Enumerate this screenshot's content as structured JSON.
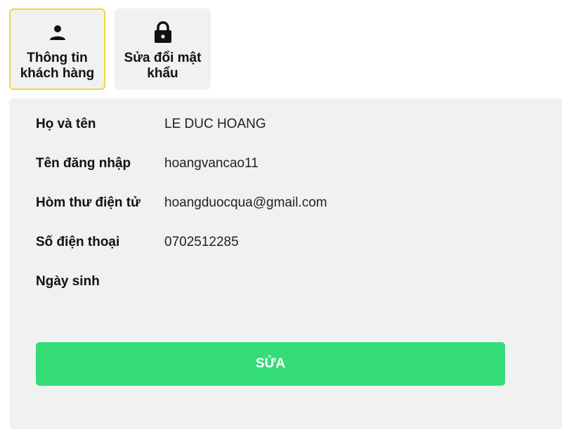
{
  "tabs": [
    {
      "label": "Thông tin khách hàng",
      "icon": "person-icon",
      "active": true
    },
    {
      "label": "Sửa đổi mật khẩu",
      "icon": "lock-icon",
      "active": false
    }
  ],
  "profile": {
    "fields": [
      {
        "label": "Họ và tên",
        "value": "LE DUC HOANG"
      },
      {
        "label": "Tên đăng nhập",
        "value": "hoangvancao11"
      },
      {
        "label": "Hòm thư điện tử",
        "value": "hoangduocqua@gmail.com"
      },
      {
        "label": "Số điện thoại",
        "value": "0702512285"
      },
      {
        "label": "Ngày sinh",
        "value": ""
      }
    ],
    "edit_label": "SỬA"
  },
  "colors": {
    "active_border": "#f2d63a",
    "panel_bg": "#f0f1f1",
    "button_bg": "#34dc78"
  }
}
